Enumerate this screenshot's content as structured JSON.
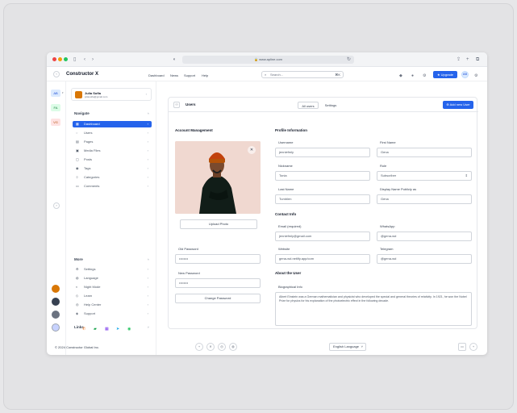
{
  "browser": {
    "url": "www.apline.com"
  },
  "app": {
    "brand": "Constructor X",
    "nav": [
      "Dashboard",
      "News",
      "Support",
      "Help"
    ],
    "search_placeholder": "Search...",
    "search_shortcut": "⌘K",
    "upgrade_label": "Upgrade",
    "user_initials": "AB"
  },
  "rail": {
    "items": [
      "AB",
      "FA",
      "VG"
    ]
  },
  "sidebar": {
    "profile_name": "Julia Sofia",
    "profile_email": "juliasofia@gmail.com",
    "navigate_title": "Navigate",
    "navigate_items": [
      {
        "label": "Dashboard",
        "icon": "▦"
      },
      {
        "label": "Users",
        "icon": "◌"
      },
      {
        "label": "Pages",
        "icon": "▤"
      },
      {
        "label": "Media Files",
        "icon": "▣"
      },
      {
        "label": "Posts",
        "icon": "▢"
      },
      {
        "label": "Tags",
        "icon": "◉"
      },
      {
        "label": "Categories",
        "icon": "⊹"
      },
      {
        "label": "Comments",
        "icon": "▭"
      }
    ],
    "more_title": "More",
    "more_items": [
      {
        "label": "Settings",
        "icon": "⚙"
      },
      {
        "label": "Language",
        "icon": "◍"
      },
      {
        "label": "Night Mode",
        "icon": "◐"
      },
      {
        "label": "Learn",
        "icon": "◇"
      },
      {
        "label": "Help Center",
        "icon": "◎"
      },
      {
        "label": "Support",
        "icon": "◈"
      }
    ],
    "links_title": "Links"
  },
  "main": {
    "title": "Users",
    "tabs": [
      "All users",
      "Settings"
    ],
    "add_label": "Add new User",
    "account_title": "Account Management",
    "upload_label": "Upload Photo",
    "old_password_label": "Old Password",
    "old_password_value": "••••••••",
    "new_password_label": "New Password",
    "new_password_value": "••••••••",
    "change_password_label": "Change Password",
    "profile_title": "Profile Information",
    "fields": {
      "username_label": "Username",
      "username_value": "jenniefmly",
      "firstname_label": "First Name",
      "firstname_value": "Gena",
      "nickname_label": "Nickname",
      "nickname_value": "Tonia",
      "role_label": "Role",
      "role_value": "Subscriber",
      "lastname_label": "Last Name",
      "lastname_value": "Tumblen",
      "display_label": "Display Name Publicly as",
      "display_value": "Gena"
    },
    "contact_title": "Contact Info",
    "contact": {
      "email_label": "Email (required)",
      "email_value": "jenniefmly@gmail.com",
      "whatsapp_label": "WhatsApp",
      "whatsapp_value": "@gena-wd",
      "website_label": "Website",
      "website_value": "gena-wd.netlify.app/com",
      "telegram_label": "Telegram",
      "telegram_value": "@gena-wd"
    },
    "about_title": "About the User",
    "bio_label": "Biographical Info",
    "bio_text": "Albert Einstein was a German mathematician and physicist who developed the special and general theories of relativity. In 1921, he won the Nobel Prize for physics for his explanation of the photoelectric effect in the following decade."
  },
  "footer": {
    "copyright": "© 2024 Constructor Global Inc.",
    "language": "English Language"
  }
}
